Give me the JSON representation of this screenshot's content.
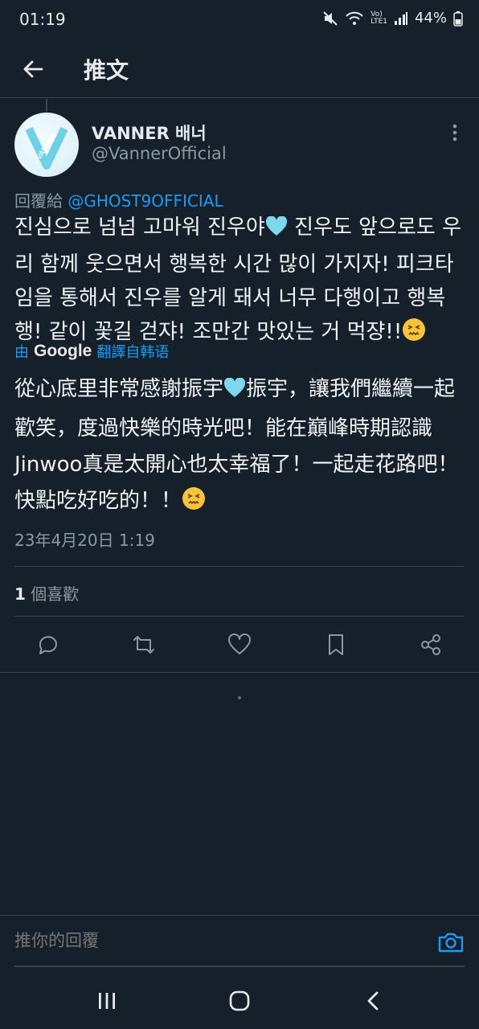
{
  "status_bar": {
    "time": "01:19",
    "battery": "44%",
    "icons": [
      "mute-icon",
      "wifi-icon",
      "volte-icon",
      "signal-icon",
      "battery-icon"
    ]
  },
  "header": {
    "title": "推文",
    "back_icon": "back-arrow-icon"
  },
  "tweet": {
    "display_name": "VANNER 배너",
    "handle": "@VannerOfficial",
    "avatar_text": "VANNER",
    "reply_prefix": "回覆給",
    "reply_to": "@GHOST9OFFICIAL",
    "text_lines": [
      "진심으로 넘넘 고마워 진우야",
      " 진우도 앞으로도 우리 함께 웃으면서 행복한 시간 많이 가지자! 피크타임을 통해서 진우를 알게 돼서 너무 다행이고 행복행! 같이 꽃길 걷쟈! 조만간 맛있는 거 먹쟝!!"
    ],
    "translate_prefix": "由",
    "translate_brand": "Google",
    "translate_suffix": "翻譯自韩语",
    "translated_lines": [
      "從心底里非常感謝振宇",
      "振宇，讓我們繼續一起歡笑，度過快樂的時光吧！能在巔峰時期認識Jinwoo真是太開心也太幸福了！一起走花路吧！快點吃好吃的！！"
    ],
    "timestamp": "23年4月20日 1:19",
    "likes_count": "1",
    "likes_label": " 個喜歡"
  },
  "actions": [
    "reply-icon",
    "retweet-icon",
    "like-icon",
    "bookmark-icon",
    "share-icon"
  ],
  "composer": {
    "placeholder": "推你的回覆"
  },
  "colors": {
    "background": "#15202b",
    "accent": "#1d9bf0",
    "muted": "#8b98a5",
    "divider": "#38444d"
  }
}
